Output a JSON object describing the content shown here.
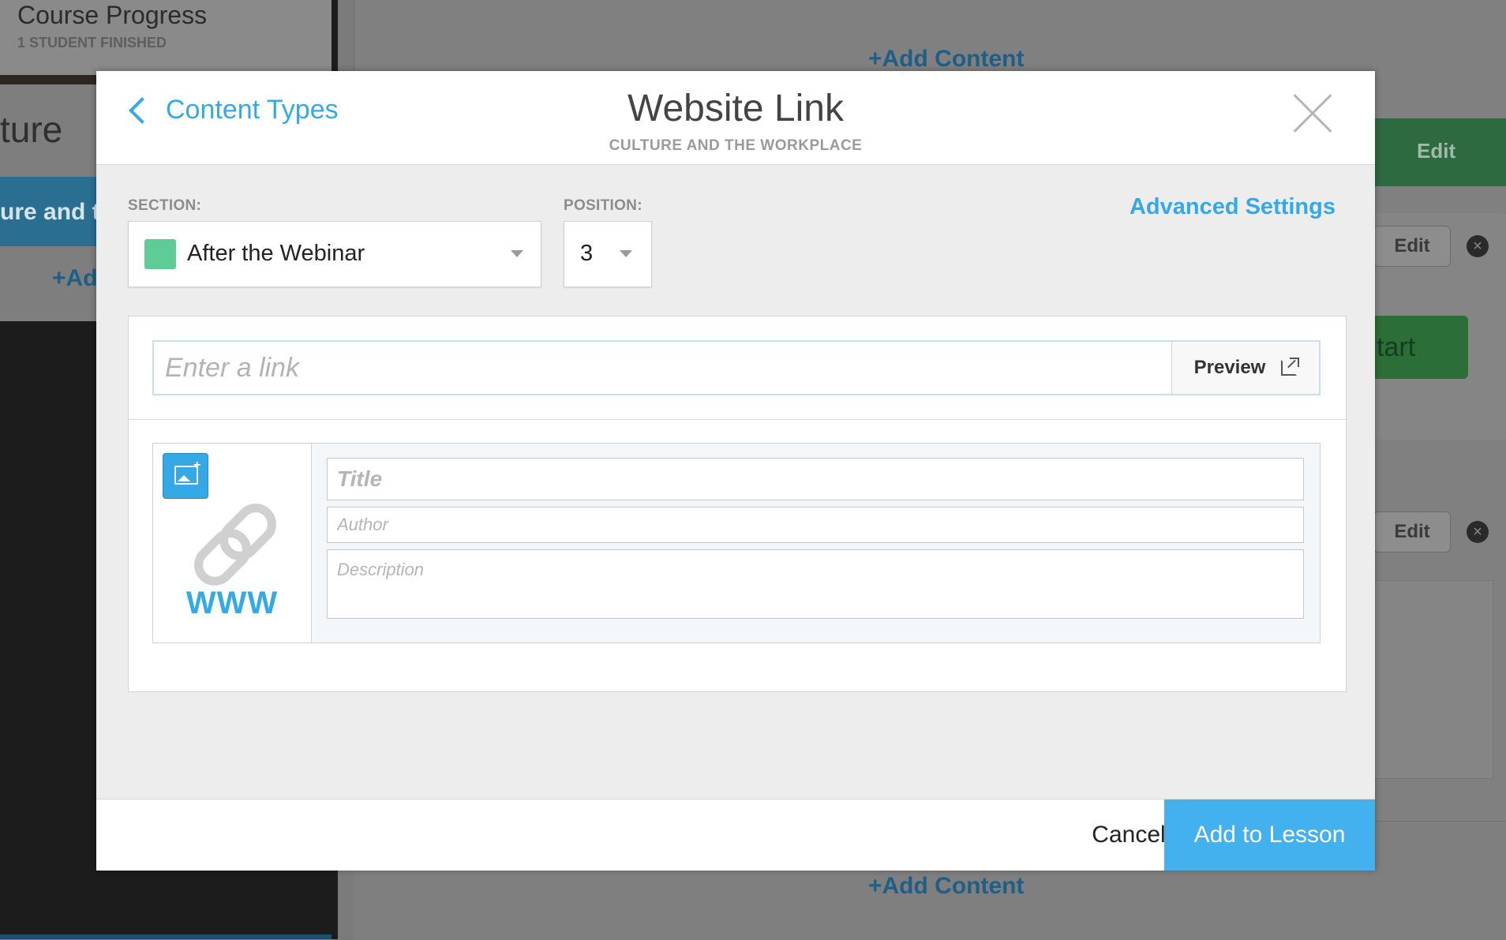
{
  "background": {
    "course_progress_title": "Course Progress",
    "course_progress_sub": "1 STUDENT FINISHED",
    "culture_text": "ture",
    "blue_bar_text": "ure and t",
    "add_content_left": "+Ad",
    "add_content_top": "+Add Content",
    "add_content_bottom": "+Add Content",
    "edit_label": "Edit",
    "start_label": "tart"
  },
  "modal": {
    "back_label": "Content Types",
    "title": "Website Link",
    "subtitle": "CULTURE AND THE WORKPLACE",
    "section_label": "SECTION:",
    "section_value": "After the Webinar",
    "section_color": "#5fcb96",
    "position_label": "POSITION:",
    "position_value": "3",
    "advanced_settings": "Advanced Settings",
    "link_placeholder": "Enter a link",
    "preview_label": "Preview",
    "www_label": "WWW",
    "title_placeholder": "Title",
    "author_placeholder": "Author",
    "description_placeholder": "Description",
    "cancel_label": "Cancel",
    "submit_label": "Add to Lesson",
    "accent_color": "#35a9e6"
  }
}
